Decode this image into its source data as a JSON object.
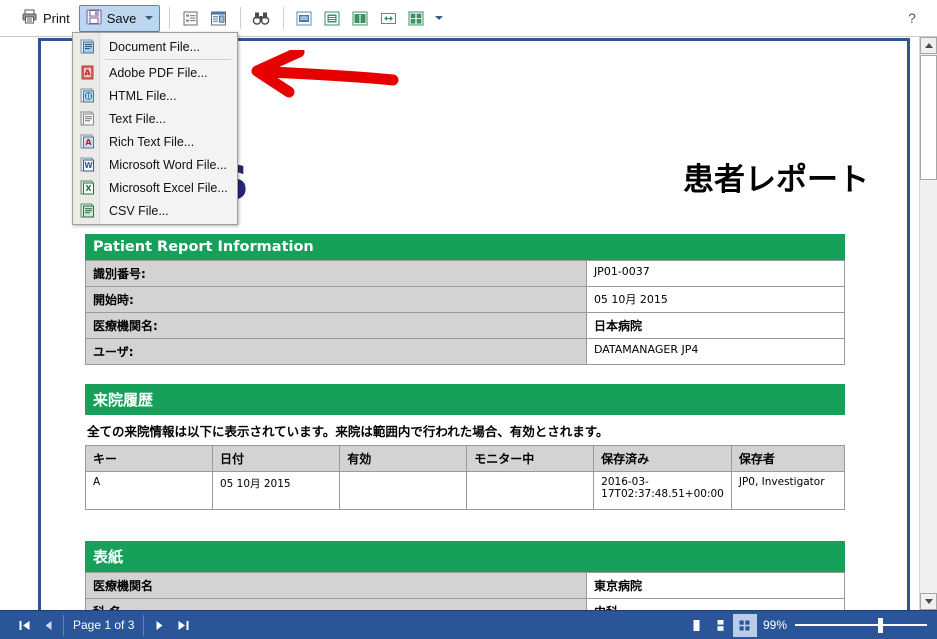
{
  "toolbar": {
    "print_label": "Print",
    "save_label": "Save",
    "help_label": "?",
    "icons": [
      "outline-panel-icon",
      "thumbnail-panel-icon",
      "binoculars-search-icon",
      "fit-page-icon",
      "single-page-icon",
      "two-page-icon",
      "fit-width-icon",
      "grid-view-icon"
    ]
  },
  "save_menu": {
    "items": [
      {
        "label": "Document File...",
        "icon": "document-file-icon"
      },
      {
        "label": "Adobe PDF File...",
        "icon": "pdf-file-icon"
      },
      {
        "label": "HTML File...",
        "icon": "html-file-icon"
      },
      {
        "label": "Text File...",
        "icon": "text-file-icon"
      },
      {
        "label": "Rich Text File...",
        "icon": "rtf-file-icon"
      },
      {
        "label": "Microsoft Word File...",
        "icon": "word-file-icon"
      },
      {
        "label": "Microsoft Excel File...",
        "icon": "excel-file-icon"
      },
      {
        "label": "CSV File...",
        "icon": "csv-file-icon"
      }
    ]
  },
  "document": {
    "logo_text": "ms",
    "title": "患者レポート",
    "sections": [
      {
        "heading": "Patient Report Information",
        "rows": [
          {
            "key": "識別番号:",
            "value": "JP01-0037",
            "bold": false
          },
          {
            "key": "開始時:",
            "value": "05 10月 2015",
            "bold": false
          },
          {
            "key": "医療機関名:",
            "value": "日本病院",
            "bold": true
          },
          {
            "key": "ユーザ:",
            "value": "DATAMANAGER JP4",
            "bold": false
          }
        ]
      },
      {
        "heading": "来院履歴",
        "note": "全ての来院情報は以下に表示されています。来院は範囲内で行われた場合、有効とされます。",
        "columns": [
          "キー",
          "日付",
          "有効",
          "モニター中",
          "保存済み",
          "保存者"
        ],
        "rows": [
          [
            "A",
            "05 10月 2015",
            "",
            "",
            "2016-03-17T02:37:48.51+00:00",
            "JP0, Investigator"
          ]
        ]
      },
      {
        "heading": "表紙",
        "rows": [
          {
            "key": "医療機関名",
            "value": "東京病院",
            "bold": true
          },
          {
            "key": "科 名",
            "value": "内科",
            "bold": true
          }
        ]
      }
    ]
  },
  "statusbar": {
    "first_page_label": "⏮",
    "prev_page_label": "◀",
    "page_label": "Page 1 of 3",
    "next_page_label": "▶",
    "last_page_label": "⏭",
    "zoom_label": "99%",
    "view_modes": [
      "single-page-view",
      "continuous-view",
      "multi-page-view"
    ],
    "selected_view_mode": 2
  },
  "colors": {
    "section_green": "#16a05a",
    "statusbar_blue": "#2a5699",
    "page_border_blue": "#2c5690",
    "logo_navy": "#262673",
    "annotation_red": "#e60000"
  }
}
